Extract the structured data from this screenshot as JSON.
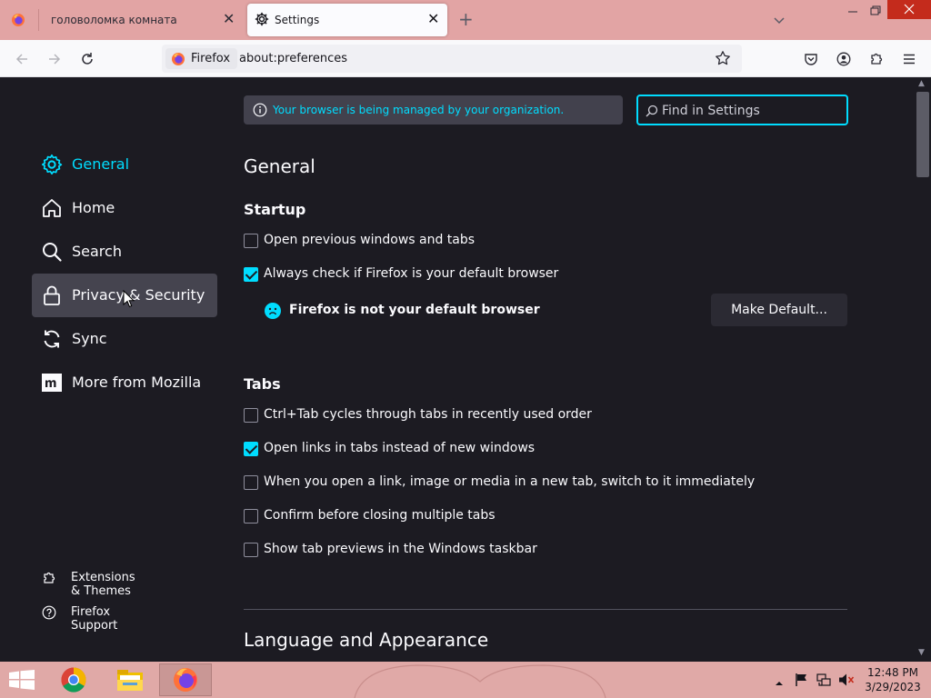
{
  "window": {
    "tabs": [
      {
        "title": "головоломка комната",
        "active": false
      },
      {
        "title": "Settings",
        "active": true
      }
    ]
  },
  "navbar": {
    "identity_label": "Firefox",
    "url": "about:preferences"
  },
  "sidebar": {
    "categories": [
      {
        "label": "General",
        "icon": "gear-icon",
        "state": "current"
      },
      {
        "label": "Home",
        "icon": "home-icon",
        "state": "normal"
      },
      {
        "label": "Search",
        "icon": "search-icon",
        "state": "normal"
      },
      {
        "label": "Privacy & Security",
        "icon": "lock-icon",
        "state": "hover"
      },
      {
        "label": "Sync",
        "icon": "sync-icon",
        "state": "normal"
      },
      {
        "label": "More from Mozilla",
        "icon": "mozilla-icon",
        "state": "normal"
      }
    ],
    "footer": [
      {
        "label": "Extensions & Themes",
        "icon": "puzzle-icon"
      },
      {
        "label": "Firefox Support",
        "icon": "help-icon"
      }
    ]
  },
  "main": {
    "policy_notice": "Your browser is being managed by your organization.",
    "search_placeholder": "Find in Settings",
    "page_title": "General",
    "startup": {
      "heading": "Startup",
      "options": [
        {
          "label": "Open previous windows and tabs",
          "checked": false
        },
        {
          "label": "Always check if Firefox is your default browser",
          "checked": true
        }
      ],
      "default_status": "Firefox is not your default browser",
      "make_default_button": "Make Default..."
    },
    "tabs": {
      "heading": "Tabs",
      "options": [
        {
          "label": "Ctrl+Tab cycles through tabs in recently used order",
          "checked": false
        },
        {
          "label": "Open links in tabs instead of new windows",
          "checked": true
        },
        {
          "label": "When you open a link, image or media in a new tab, switch to it immediately",
          "checked": false
        },
        {
          "label": "Confirm before closing multiple tabs",
          "checked": false
        },
        {
          "label": "Show tab previews in the Windows taskbar",
          "checked": false
        }
      ]
    },
    "next_section_heading": "Language and Appearance"
  },
  "taskbar": {
    "apps": [
      "chrome-icon",
      "file-explorer-icon",
      "firefox-icon"
    ],
    "active_app": "firefox-icon",
    "time": "12:48 PM",
    "date": "3/29/2023"
  },
  "colors": {
    "accent": "#00ddff",
    "background": "#1c1b22",
    "tabbar": "#e2a4a4",
    "selected_item": "#45444f"
  }
}
